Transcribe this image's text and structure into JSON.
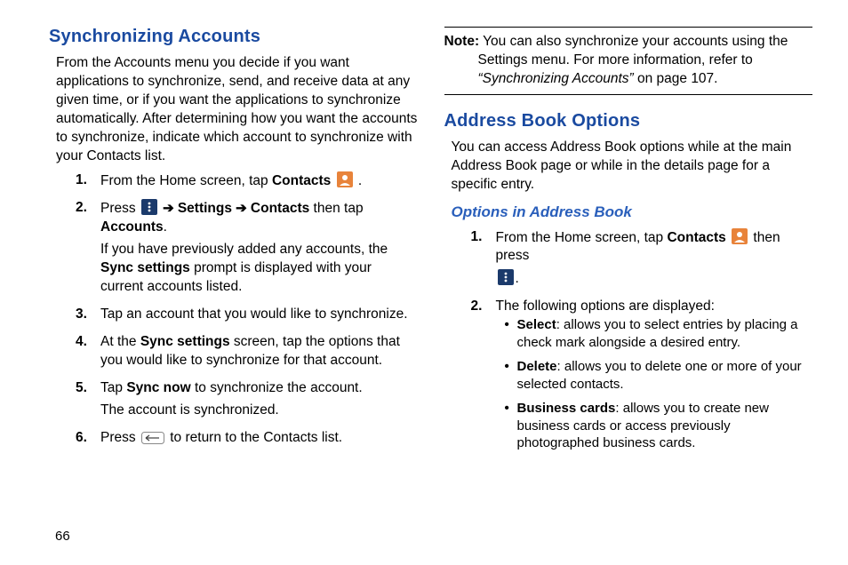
{
  "page_number": "66",
  "left": {
    "heading": "Synchronizing Accounts",
    "intro": "From the Accounts menu you decide if you want applications to synchronize, send, and receive data at any given time, or if you want the applications to synchronize automatically. After determining how you want the accounts to synchronize, indicate which account to synchronize with your Contacts list.",
    "steps": [
      {
        "num": "1.",
        "pre": "From the Home screen, tap ",
        "b1": "Contacts",
        "post": " ."
      },
      {
        "num": "2.",
        "pre": "Press ",
        "arrow1": " ➔ ",
        "b1": "Settings",
        "arrow2": " ➔ ",
        "b2": "Contacts",
        "mid": " then tap ",
        "b3": "Accounts",
        "post": ".",
        "sub_pre": "If you have previously added any accounts, the ",
        "sub_b": "Sync settings",
        "sub_post": " prompt is displayed with your current accounts listed."
      },
      {
        "num": "3.",
        "text": "Tap an account that you would like to synchronize."
      },
      {
        "num": "4.",
        "pre": "At the ",
        "b1": "Sync settings",
        "post": " screen, tap the options that you would like to synchronize for that account."
      },
      {
        "num": "5.",
        "pre": "Tap ",
        "b1": "Sync now",
        "post": " to synchronize the account.",
        "sub": "The account is synchronized."
      },
      {
        "num": "6.",
        "pre": "Press ",
        "post": " to return to the Contacts list."
      }
    ]
  },
  "right": {
    "note_label": "Note:",
    "note_line1": " You can also synchronize your accounts using the",
    "note_line2": "Settings menu. For more information, refer to ",
    "note_ref": "“Synchronizing Accounts”",
    "note_page": "  on page 107.",
    "heading": "Address Book Options",
    "intro": "You can access Address Book options while at the main Address Book page or while in the details page for a specific entry.",
    "subheading": "Options in Address Book",
    "steps": [
      {
        "num": "1.",
        "pre": "From the Home screen, tap ",
        "b1": "Contacts",
        "mid": " then press ",
        "post": "."
      },
      {
        "num": "2.",
        "text": "The following options are displayed:"
      }
    ],
    "bullets": [
      {
        "b": "Select",
        "text": ": allows you to select entries by placing a check mark alongside a desired entry."
      },
      {
        "b": "Delete",
        "text": ": allows you to delete one or more of your selected contacts."
      },
      {
        "b": "Business cards",
        "text": ": allows you to create new business cards or access previously photographed business cards."
      }
    ]
  }
}
